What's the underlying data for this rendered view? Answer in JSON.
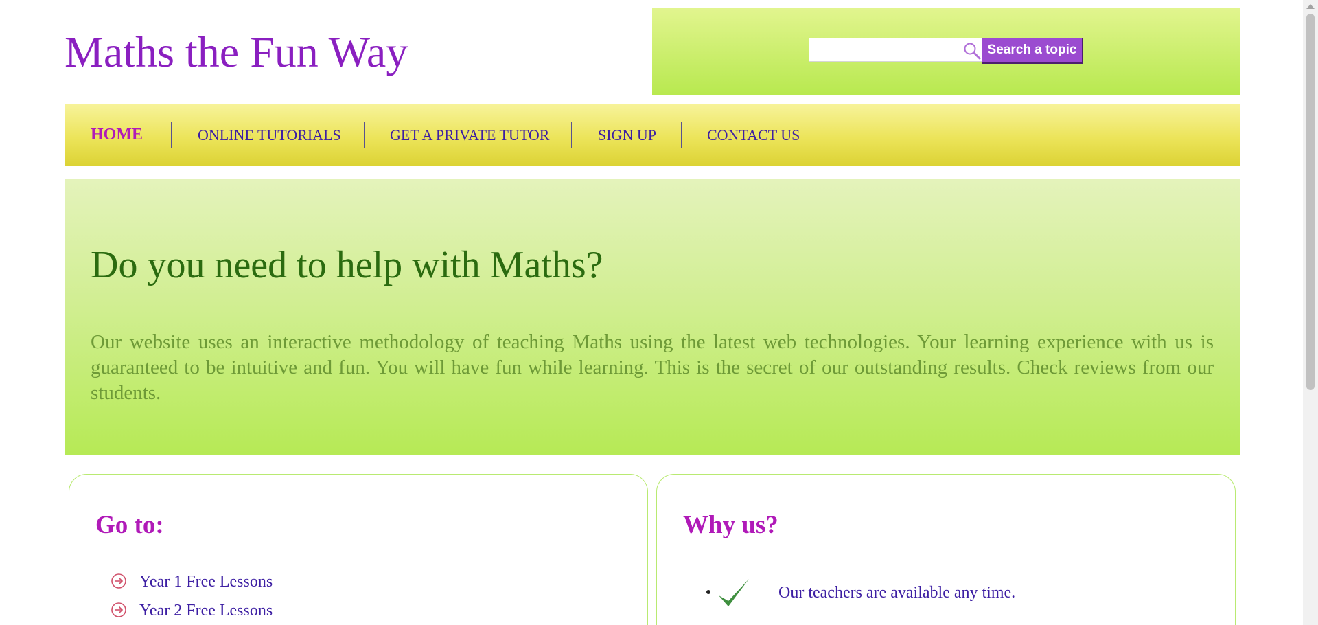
{
  "header": {
    "site_title": "Maths the Fun Way",
    "search": {
      "placeholder": "",
      "value": "",
      "button_label": "Search a topic"
    }
  },
  "nav": {
    "items": [
      {
        "label": "HOME",
        "active": true
      },
      {
        "label": "ONLINE TUTORIALS",
        "active": false
      },
      {
        "label": "GET A PRIVATE TUTOR",
        "active": false
      },
      {
        "label": "SIGN UP",
        "active": false
      },
      {
        "label": "CONTACT US",
        "active": false
      }
    ]
  },
  "hero": {
    "title": "Do you need to help with Maths?",
    "text": "Our website uses an interactive methodology of teaching Maths using the latest web technologies. Your learning experience with us is guaranteed to be intuitive and fun. You will have fun while learning. This is the secret of our outstanding results. Check reviews from our students."
  },
  "goto": {
    "title": "Go to:",
    "items": [
      {
        "label": "Year 1 Free Lessons",
        "icon": "circle-arrow-right-icon"
      },
      {
        "label": "Year 2 Free Lessons",
        "icon": "circle-arrow-right-icon"
      }
    ]
  },
  "why": {
    "title": "Why us?",
    "items": [
      {
        "label": "Our teachers are available any time.",
        "icon": "checkmark-icon"
      }
    ]
  },
  "colors": {
    "title_purple": "#8a1fc0",
    "nav_text": "#3d1fa3",
    "nav_active": "#b01ab8",
    "hero_title": "#2b6b10",
    "hero_text": "#6e9a37",
    "search_button": "#9b4bd0",
    "check_green": "#3f8f3f",
    "arrow_red": "#d0506a"
  }
}
